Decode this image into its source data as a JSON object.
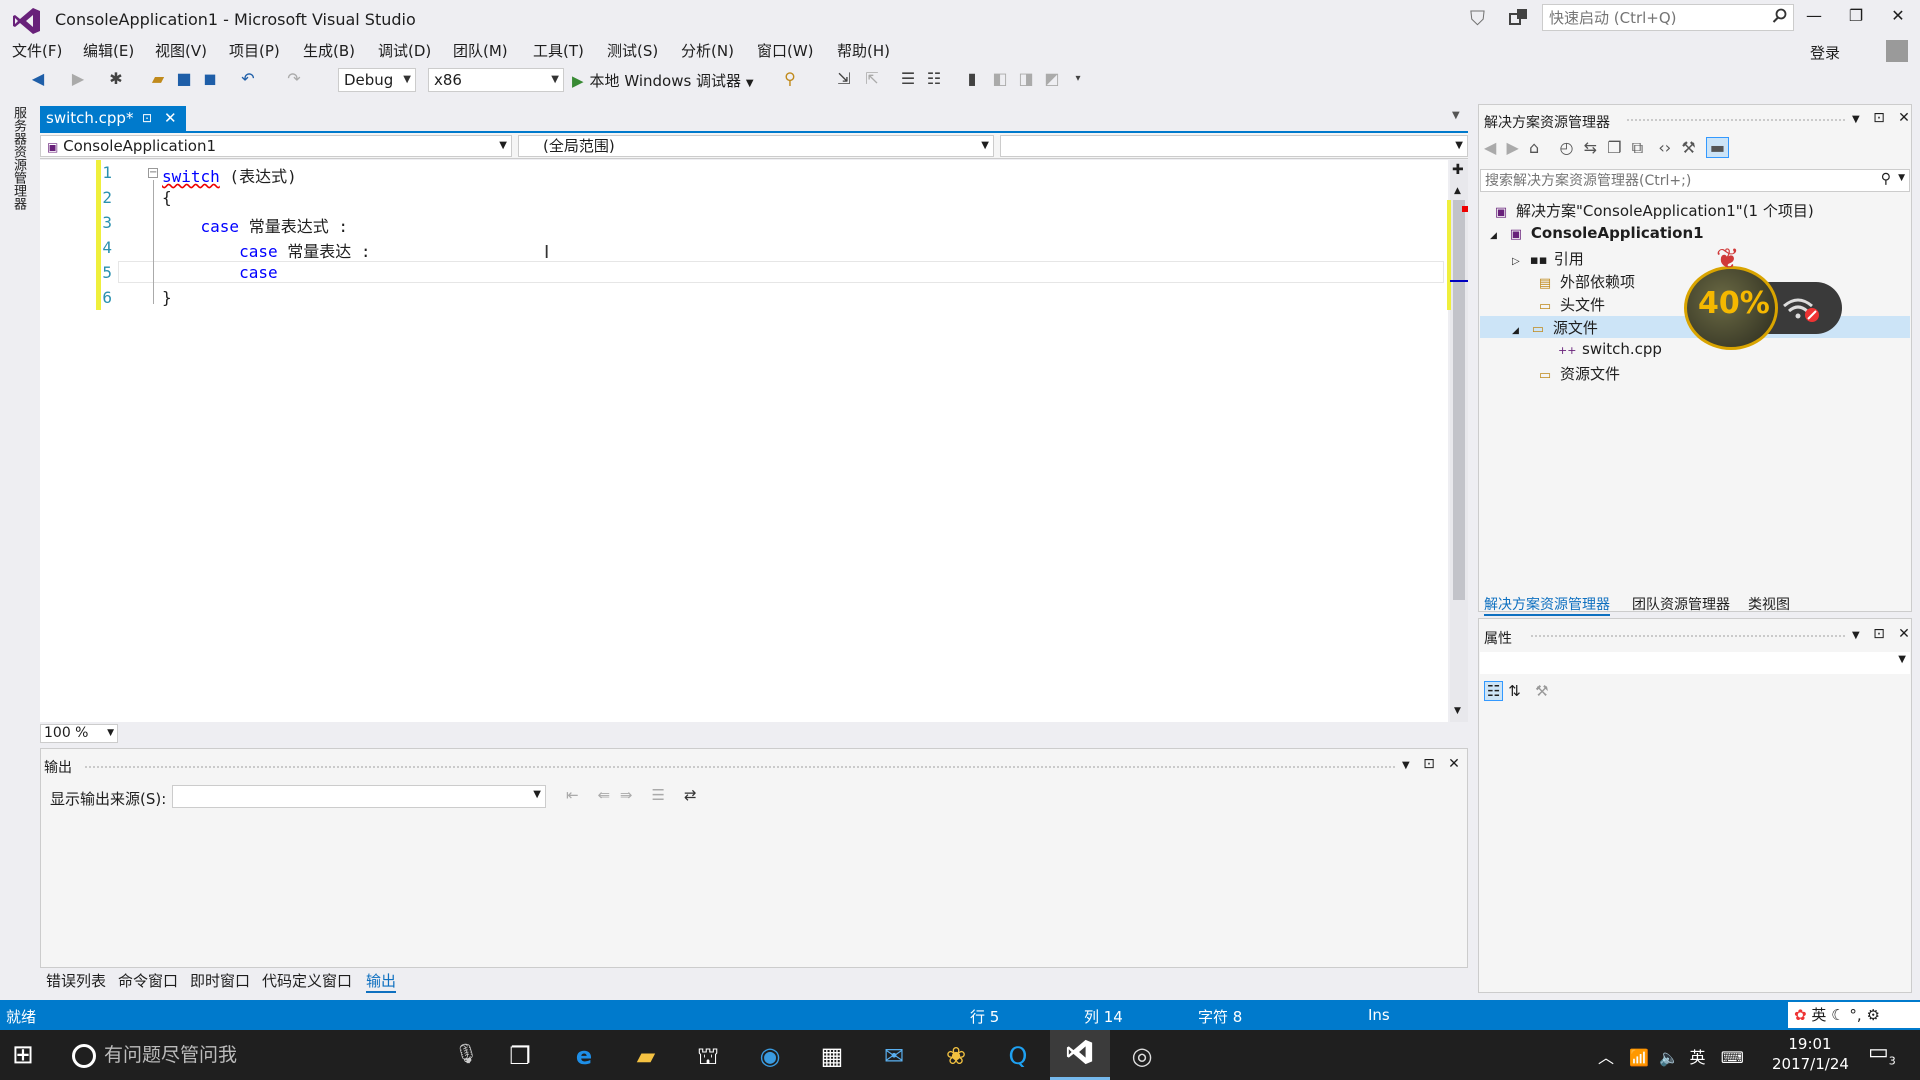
{
  "window": {
    "title": "ConsoleApplication1 - Microsoft Visual Studio",
    "quick_launch_placeholder": "快速启动 (Ctrl+Q)",
    "signin_label": "登录",
    "minimize_glyph": "—",
    "restore_glyph": "❐",
    "close_glyph": "✕"
  },
  "menu": [
    "文件(F)",
    "编辑(E)",
    "视图(V)",
    "项目(P)",
    "生成(B)",
    "调试(D)",
    "团队(M)",
    "工具(T)",
    "测试(S)",
    "分析(N)",
    "窗口(W)",
    "帮助(H)"
  ],
  "toolbar": {
    "config": "Debug",
    "platform": "x86",
    "run_label": "本地 Windows 调试器"
  },
  "side_tab": "服务器资源管理器",
  "editor": {
    "tab_label": "switch.cpp*",
    "nav_project": "ConsoleApplication1",
    "nav_scope": "(全局范围)",
    "nav_member": "",
    "zoom": "100 %",
    "lines": [
      {
        "no": "1",
        "segments": [
          {
            "t": "switch",
            "k": "kw sq"
          },
          {
            "t": " (表达式)",
            "k": ""
          }
        ]
      },
      {
        "no": "2",
        "segments": [
          {
            "t": "{",
            "k": ""
          }
        ]
      },
      {
        "no": "3",
        "segments": [
          {
            "t": "    case",
            "k": "kw"
          },
          {
            "t": " 常量表达式 :",
            "k": ""
          }
        ]
      },
      {
        "no": "4",
        "segments": [
          {
            "t": "        case",
            "k": "kw"
          },
          {
            "t": " 常量表达 :",
            "k": ""
          }
        ]
      },
      {
        "no": "5",
        "segments": [
          {
            "t": "        case",
            "k": "kw"
          }
        ]
      },
      {
        "no": "6",
        "segments": [
          {
            "t": "}",
            "k": ""
          }
        ]
      }
    ]
  },
  "output": {
    "title": "输出",
    "source_label": "显示输出来源(S):",
    "source_value": ""
  },
  "bottom_tabs": [
    {
      "label": "错误列表",
      "active": false
    },
    {
      "label": "命令窗口",
      "active": false
    },
    {
      "label": "即时窗口",
      "active": false
    },
    {
      "label": "代码定义窗口",
      "active": false
    },
    {
      "label": "输出",
      "active": true
    }
  ],
  "solution_explorer": {
    "title": "解决方案资源管理器",
    "search_placeholder": "搜索解决方案资源管理器(Ctrl+;)",
    "tree": [
      {
        "label": "解决方案\"ConsoleApplication1\"(1 个项目)",
        "icon": "solution-icon",
        "glyph": "▣",
        "expander": "",
        "bold": false
      },
      {
        "label": "ConsoleApplication1",
        "icon": "project-icon",
        "glyph": "▣",
        "expander": "◢",
        "bold": true
      },
      {
        "label": "引用",
        "icon": "references-icon",
        "glyph": "▪▪",
        "expander": "▷",
        "bold": false
      },
      {
        "label": "外部依赖项",
        "icon": "external-deps-icon",
        "glyph": "▤",
        "expander": "",
        "bold": false
      },
      {
        "label": "头文件",
        "icon": "folder-icon",
        "glyph": "▭",
        "expander": "",
        "bold": false
      },
      {
        "label": "源文件",
        "icon": "folder-open-icon",
        "glyph": "▭",
        "expander": "◢",
        "bold": false
      },
      {
        "label": "switch.cpp",
        "icon": "cpp-file-icon",
        "glyph": "++",
        "expander": "",
        "bold": false
      },
      {
        "label": "资源文件",
        "icon": "folder-icon",
        "glyph": "▭",
        "expander": "",
        "bold": false
      }
    ],
    "bottom_tabs": [
      {
        "label": "解决方案资源管理器",
        "active": true
      },
      {
        "label": "团队资源管理器",
        "active": false
      },
      {
        "label": "类视图",
        "active": false
      }
    ]
  },
  "properties": {
    "title": "属性"
  },
  "badge": {
    "value": "40%"
  },
  "status": {
    "ready": "就绪",
    "line": "行 5",
    "col": "列 14",
    "char": "字符 8",
    "mode": "Ins",
    "ime": "英"
  },
  "taskbar": {
    "search_placeholder": "有问题尽管问我",
    "tray_lang": "英",
    "time": "19:01",
    "date": "2017/1/24",
    "notification_count": "3"
  },
  "colors": {
    "accent": "#007acc",
    "keyword": "#0000ff",
    "line_number": "#2b91af",
    "change_bar": "#efef3c"
  }
}
